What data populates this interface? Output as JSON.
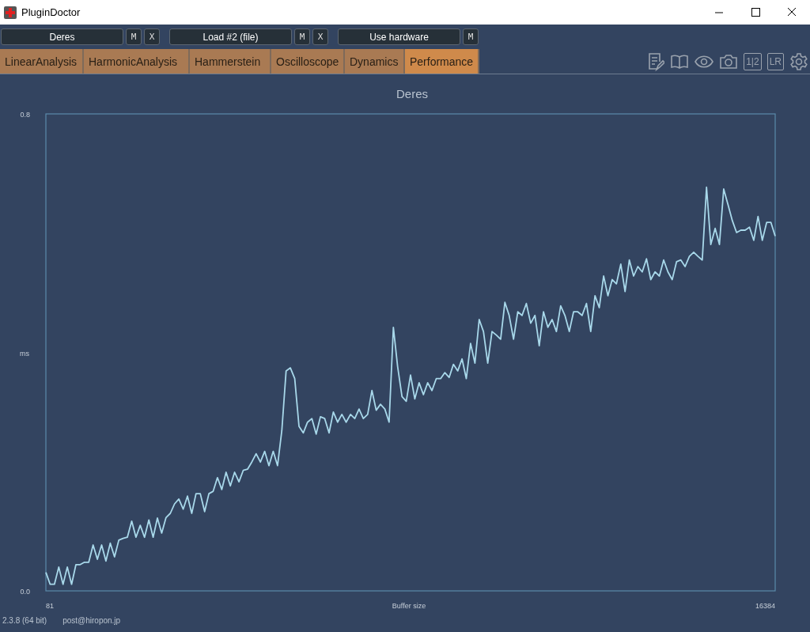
{
  "window": {
    "title": "PluginDoctor"
  },
  "toolbar": [
    {
      "label": "Deres",
      "buttons": [
        "M",
        "X"
      ]
    },
    {
      "label": "Load #2 (file)",
      "buttons": [
        "M",
        "X"
      ]
    },
    {
      "label": "Use hardware",
      "buttons": [
        "M"
      ]
    }
  ],
  "tabs": [
    {
      "label": "LinearAnalysis",
      "selected": false
    },
    {
      "label": "HarmonicAnalysis",
      "selected": false
    },
    {
      "label": "Hammerstein",
      "selected": false
    },
    {
      "label": "Oscilloscope",
      "selected": false
    },
    {
      "label": "Dynamics",
      "selected": false
    },
    {
      "label": "Performance",
      "selected": true
    }
  ],
  "tool_icons": [
    {
      "kind": "notes"
    },
    {
      "kind": "book"
    },
    {
      "kind": "eye"
    },
    {
      "kind": "camera"
    },
    {
      "kind": "text",
      "label": "1|2"
    },
    {
      "kind": "text",
      "label": "LR"
    },
    {
      "kind": "gear"
    }
  ],
  "chart": {
    "x_start_label": "81",
    "x_end_label": "16384",
    "chart_data": {
      "type": "line",
      "title": "Deres",
      "xlabel": "Buffer size",
      "ylabel": "ms",
      "ylim": [
        0,
        0.8
      ],
      "yticks": [
        {
          "value": 0,
          "label": "0.0"
        },
        {
          "value": 0.8,
          "label": "0.8"
        }
      ],
      "series": [
        {
          "color": "#a8d8ea",
          "values": [
            0.031,
            0.011,
            0.011,
            0.04,
            0.011,
            0.04,
            0.011,
            0.044,
            0.044,
            0.048,
            0.048,
            0.077,
            0.053,
            0.077,
            0.05,
            0.08,
            0.057,
            0.085,
            0.088,
            0.09,
            0.117,
            0.09,
            0.11,
            0.09,
            0.119,
            0.09,
            0.122,
            0.097,
            0.123,
            0.13,
            0.146,
            0.154,
            0.137,
            0.159,
            0.13,
            0.163,
            0.163,
            0.133,
            0.163,
            0.167,
            0.19,
            0.17,
            0.199,
            0.176,
            0.199,
            0.183,
            0.202,
            0.204,
            0.216,
            0.23,
            0.216,
            0.234,
            0.21,
            0.234,
            0.21,
            0.269,
            0.369,
            0.374,
            0.356,
            0.276,
            0.265,
            0.283,
            0.289,
            0.263,
            0.292,
            0.289,
            0.265,
            0.3,
            0.283,
            0.296,
            0.283,
            0.296,
            0.289,
            0.305,
            0.289,
            0.296,
            0.336,
            0.303,
            0.313,
            0.305,
            0.283,
            0.442,
            0.376,
            0.326,
            0.318,
            0.362,
            0.322,
            0.349,
            0.329,
            0.349,
            0.336,
            0.356,
            0.356,
            0.366,
            0.358,
            0.38,
            0.369,
            0.389,
            0.356,
            0.415,
            0.382,
            0.455,
            0.435,
            0.382,
            0.435,
            0.429,
            0.422,
            0.484,
            0.462,
            0.422,
            0.468,
            0.462,
            0.482,
            0.449,
            0.462,
            0.411,
            0.468,
            0.442,
            0.455,
            0.435,
            0.478,
            0.462,
            0.435,
            0.468,
            0.468,
            0.462,
            0.482,
            0.435,
            0.495,
            0.475,
            0.528,
            0.495,
            0.522,
            0.515,
            0.548,
            0.502,
            0.555,
            0.528,
            0.544,
            0.535,
            0.557,
            0.522,
            0.535,
            0.528,
            0.555,
            0.535,
            0.522,
            0.552,
            0.555,
            0.544,
            0.561,
            0.568,
            0.561,
            0.555,
            0.677,
            0.581,
            0.608,
            0.581,
            0.674,
            0.648,
            0.621,
            0.601,
            0.605,
            0.605,
            0.61,
            0.588,
            0.628,
            0.588,
            0.618,
            0.618,
            0.595
          ]
        }
      ]
    }
  },
  "footer": {
    "version": "2.3.8 (64 bit)",
    "contact": "post@hiropon.jp"
  }
}
